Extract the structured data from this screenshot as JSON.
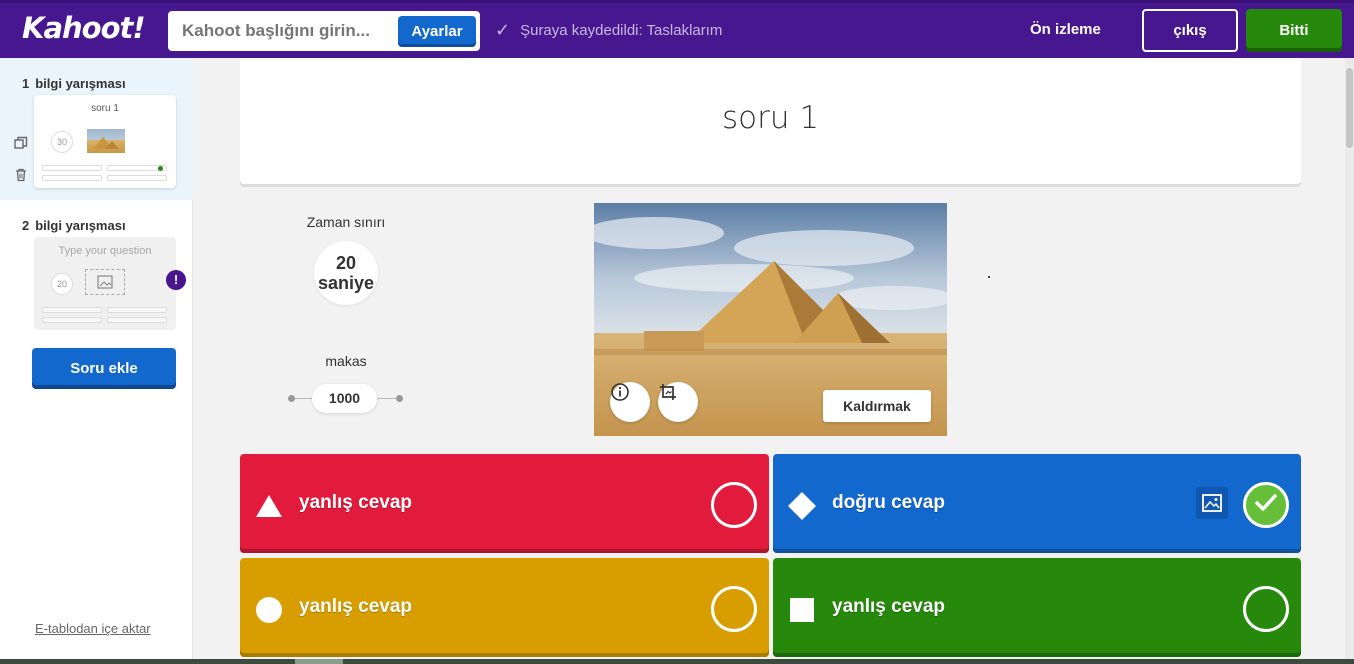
{
  "header": {
    "logo": "Kahoot!",
    "title_placeholder": "Kahoot başlığını girin...",
    "settings_label": "Ayarlar",
    "saved_status": "Şuraya kaydedildi: Taslaklarım",
    "preview_label": "Ön izleme",
    "exit_label": "çıkış",
    "done_label": "Bitti"
  },
  "sidebar": {
    "slides": [
      {
        "number": "1",
        "type": "bilgi yarışması",
        "title": "soru 1",
        "timer": "30",
        "has_image": true
      },
      {
        "number": "2",
        "type": "bilgi yarışması",
        "title": "Type your question",
        "timer": "20",
        "has_image": false,
        "warning": "!"
      }
    ],
    "add_question_label": "Soru ekle",
    "import_label": "E-tablodan içe aktar"
  },
  "question": {
    "text": "soru 1",
    "time_limit_label": "Zaman sınırı",
    "time_limit_value": "20",
    "time_limit_unit": "saniye",
    "points_label": "makas",
    "points_value": "1000",
    "remove_media_label": "Kaldırmak"
  },
  "answers": [
    {
      "text": "yanlış cevap",
      "shape": "triangle",
      "color": "#e21b3c",
      "correct": false
    },
    {
      "text": "doğru cevap",
      "shape": "diamond",
      "color": "#1368ce",
      "correct": true
    },
    {
      "text": "yanlış cevap",
      "shape": "circle",
      "color": "#d89e00",
      "correct": false
    },
    {
      "text": "yanlış cevap",
      "shape": "square",
      "color": "#26890c",
      "correct": false
    }
  ],
  "colors": {
    "brand_purple": "#46178f",
    "primary_blue": "#1368ce",
    "done_green": "#26890c",
    "check_green": "#66bf39"
  },
  "icons": {
    "check": "check-icon",
    "duplicate": "duplicate-icon",
    "delete": "trash-icon",
    "info": "info-icon",
    "crop": "crop-icon",
    "image": "image-icon"
  }
}
